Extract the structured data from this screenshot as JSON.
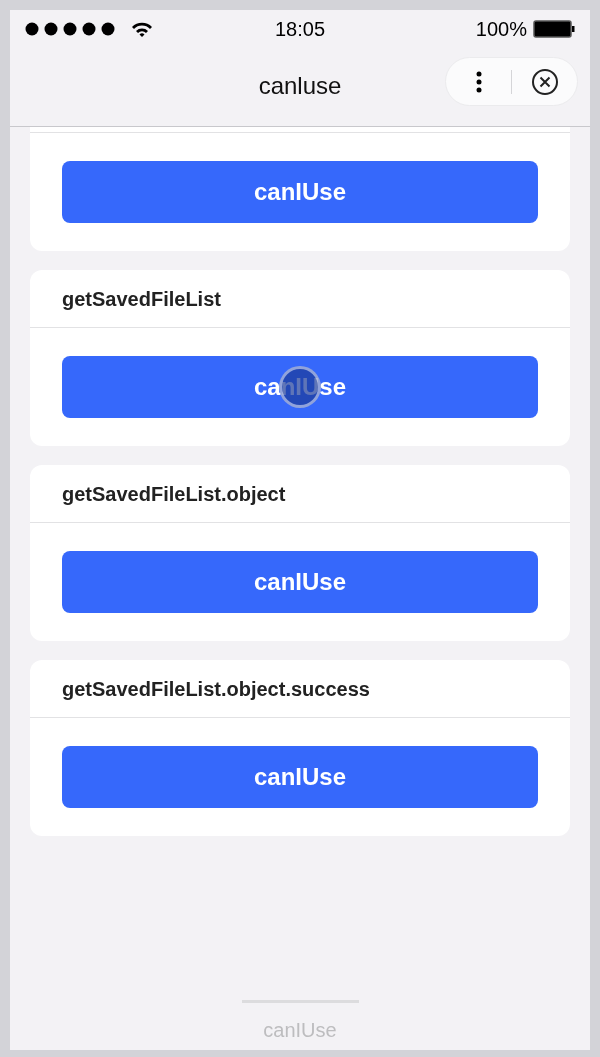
{
  "status_bar": {
    "time": "18:05",
    "battery": "100%"
  },
  "nav_bar": {
    "title": "canluse"
  },
  "cards": [
    {
      "button": "canIUse",
      "pressed": false
    },
    {
      "title": "getSavedFileList",
      "button": "canIUse",
      "pressed": true
    },
    {
      "title": "getSavedFileList.object",
      "button": "canIUse",
      "pressed": false
    },
    {
      "title": "getSavedFileList.object.success",
      "button": "canIUse",
      "pressed": false
    }
  ],
  "footer": {
    "label": "canIUse"
  }
}
